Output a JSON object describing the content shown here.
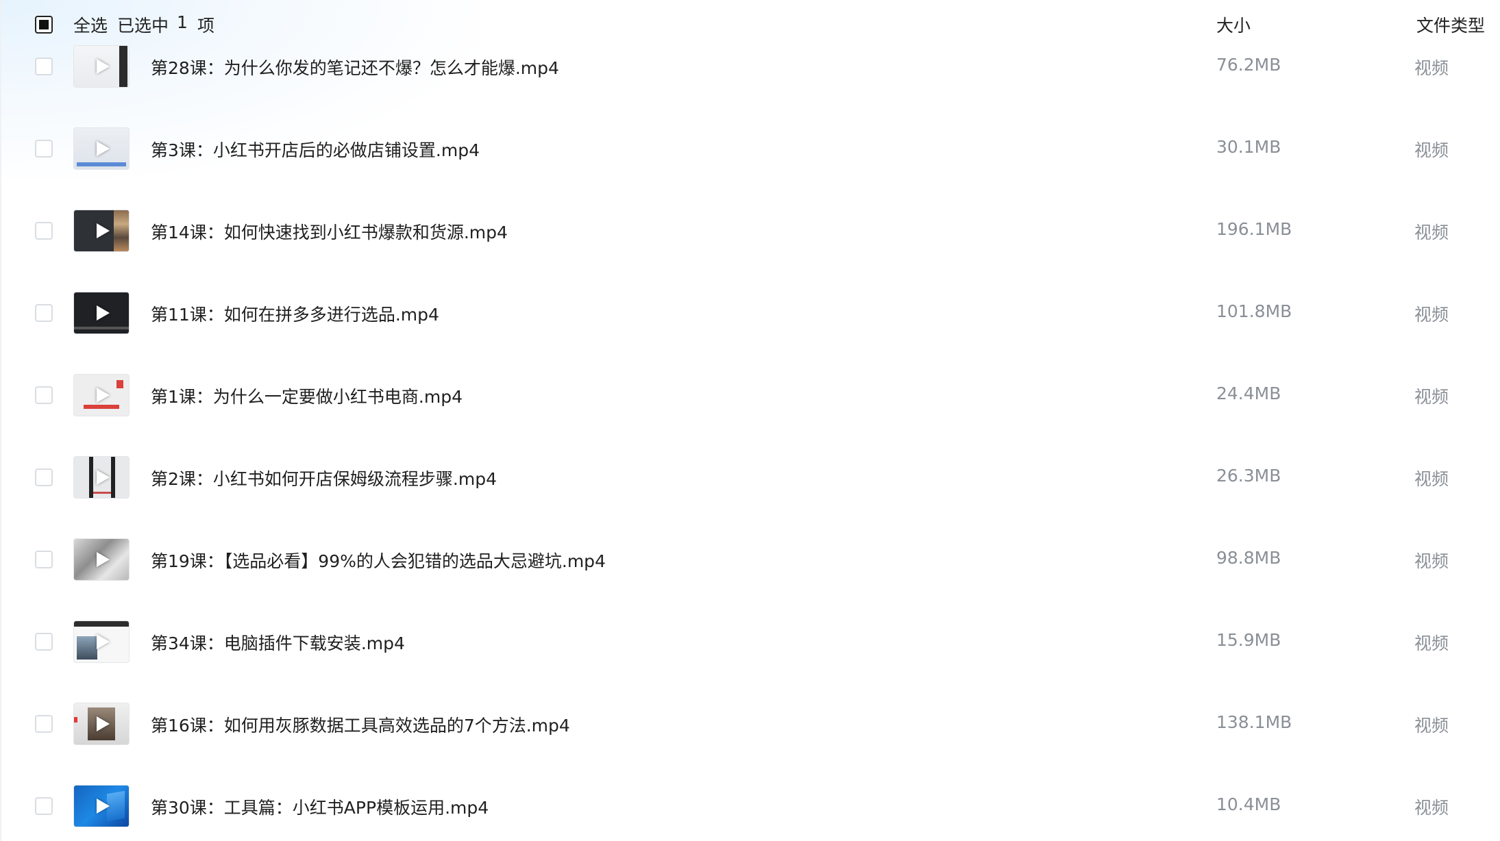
{
  "header": {
    "select_all_label": "全选",
    "selected_label": "已选中",
    "selected_count": "1",
    "selected_unit": "项",
    "size_column": "大小",
    "type_column": "文件类型"
  },
  "files": [
    {
      "name": "第28课：为什么你发的笔记还不爆？怎么才能爆.mp4",
      "size": "76.2MB",
      "type": "视频",
      "thumb_icon": "video-thumbnail"
    },
    {
      "name": "第3课：小红书开店后的必做店铺设置.mp4",
      "size": "30.1MB",
      "type": "视频",
      "thumb_icon": "video-thumbnail"
    },
    {
      "name": "第14课：如何快速找到小红书爆款和货源.mp4",
      "size": "196.1MB",
      "type": "视频",
      "thumb_icon": "video-thumbnail"
    },
    {
      "name": "第11课：如何在拼多多进行选品.mp4",
      "size": "101.8MB",
      "type": "视频",
      "thumb_icon": "video-thumbnail"
    },
    {
      "name": "第1课：为什么一定要做小红书电商.mp4",
      "size": "24.4MB",
      "type": "视频",
      "thumb_icon": "video-thumbnail"
    },
    {
      "name": "第2课：小红书如何开店保姆级流程步骤.mp4",
      "size": "26.3MB",
      "type": "视频",
      "thumb_icon": "video-thumbnail"
    },
    {
      "name": "第19课：【选品必看】99%的人会犯错的选品大忌避坑.mp4",
      "size": "98.8MB",
      "type": "视频",
      "thumb_icon": "video-thumbnail"
    },
    {
      "name": "第34课：电脑插件下载安装.mp4",
      "size": "15.9MB",
      "type": "视频",
      "thumb_icon": "video-thumbnail"
    },
    {
      "name": "第16课：如何用灰豚数据工具高效选品的7个方法.mp4",
      "size": "138.1MB",
      "type": "视频",
      "thumb_icon": "video-thumbnail"
    },
    {
      "name": "第30课：工具篇：小红书APP模板运用.mp4",
      "size": "10.4MB",
      "type": "视频",
      "thumb_icon": "video-thumbnail"
    }
  ],
  "colors": {
    "text_primary": "#1f1f1f",
    "text_secondary": "#8a8f96",
    "checkbox_border": "#d9dde2"
  }
}
